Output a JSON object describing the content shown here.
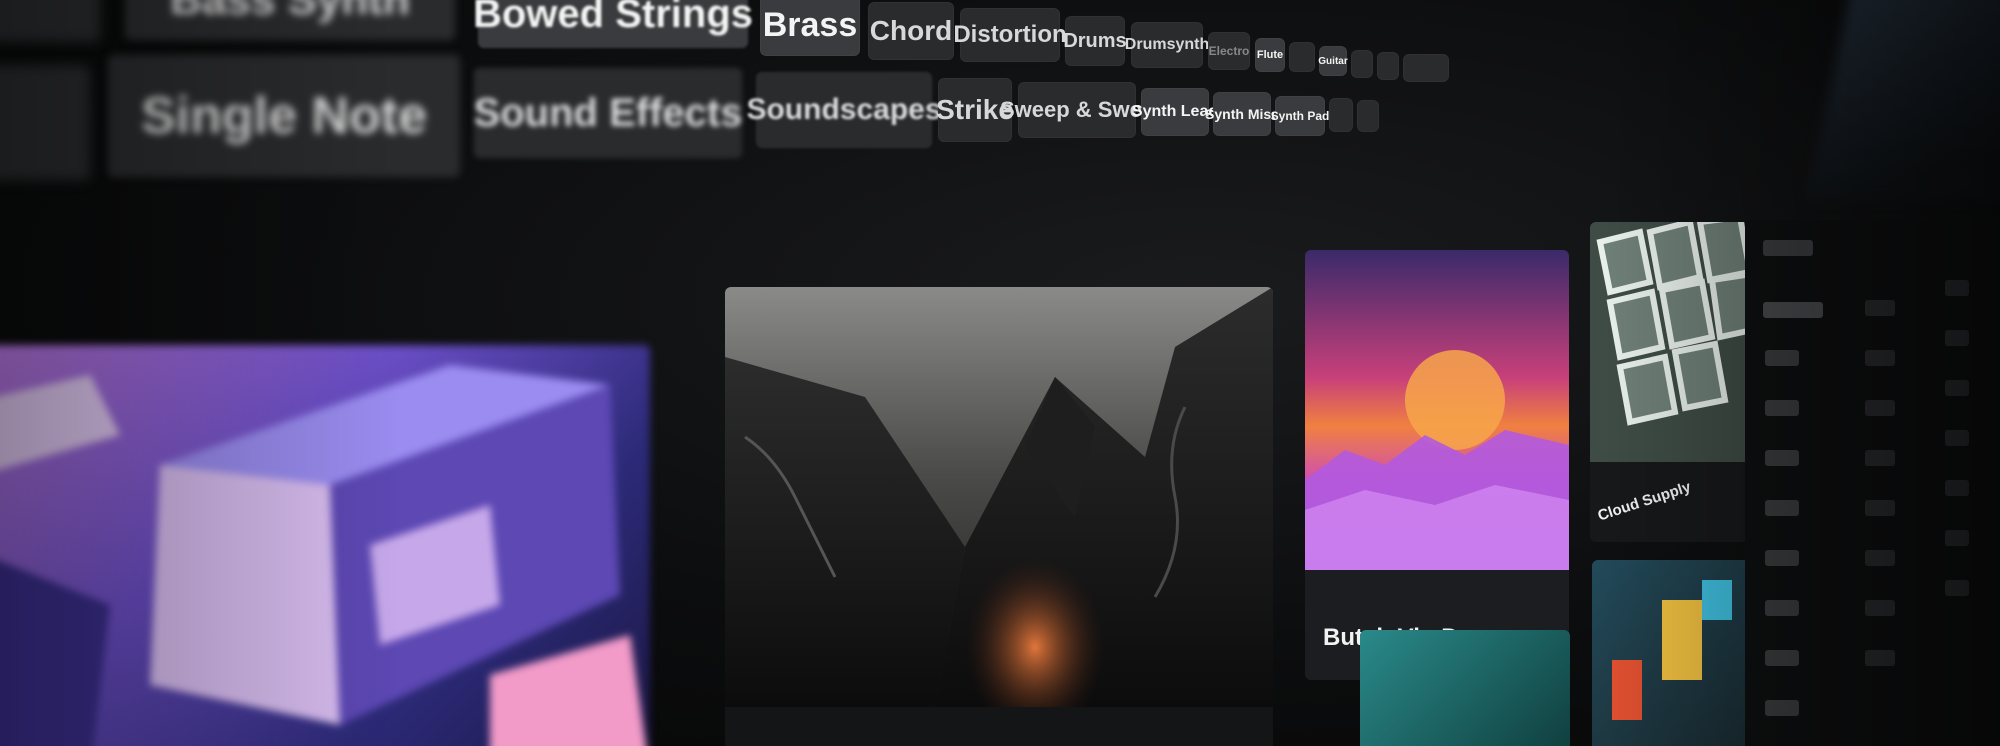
{
  "tags_row1": [
    "Bass Synth",
    "Bowed Strings",
    "Brass",
    "Chord",
    "Distortion",
    "Drums",
    "Drumsynth",
    "Electro",
    "Flute",
    "Guitar"
  ],
  "tags_row2": [
    "Single Note",
    "Sound Effects",
    "Soundscapes",
    "Strike",
    "Sweep & Swell",
    "Synth Lead",
    "Synth Misc",
    "Synth Pad"
  ],
  "cards": [
    {
      "title": ""
    },
    {
      "title": ""
    },
    {
      "title": "Butch Vig Drums"
    },
    {
      "title": "Cloud Supply"
    }
  ],
  "colors": {
    "background": "#0b0c0d",
    "tag": "#2a2b2d",
    "text": "#f2f2f2"
  }
}
